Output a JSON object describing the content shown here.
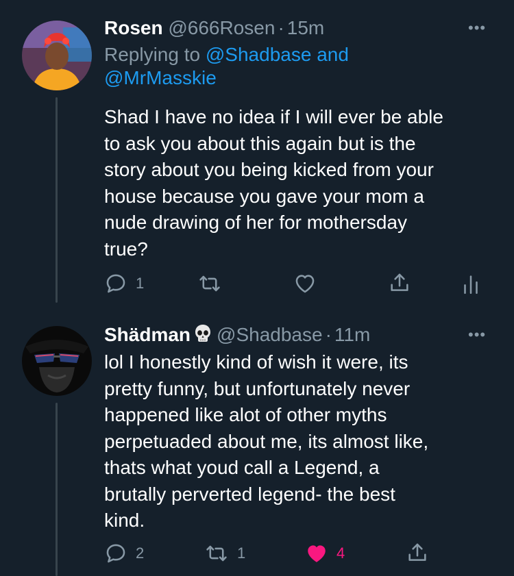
{
  "tweet1": {
    "display_name": "Rosen",
    "handle": "@666Rosen",
    "separator": "·",
    "time": "15m",
    "replying_prefix": "Replying to",
    "replying_user1": "@Shadbase",
    "replying_and": "and",
    "replying_user2": "@MrMasskie",
    "lines": [
      "Shad I have no idea if I will ever be able",
      "to ask you about this again but is the",
      "story about you being kicked from your",
      "house because you gave your mom a",
      "nude drawing of her for mothersday",
      "true?"
    ],
    "reply_count": "1",
    "retweet_count": "",
    "like_count": "",
    "more_icon": "more-horizontal-icon"
  },
  "tweet2": {
    "display_name": "Shädman",
    "name_emoji": "skull-icon",
    "handle": "@Shadbase",
    "separator": "·",
    "time": "11m",
    "lines": [
      "lol I honestly kind of wish it were, its",
      "pretty funny, but unfortunately never",
      "happened like alot of other myths",
      "perpetuaded about me, its almost like,",
      "thats what youd call a Legend, a",
      "brutally perverted legend- the best",
      "kind."
    ],
    "reply_count": "2",
    "retweet_count": "1",
    "like_count": "4",
    "liked": true,
    "more_icon": "more-horizontal-icon"
  },
  "colors": {
    "background": "#15202b",
    "text": "#ffffff",
    "muted": "#8899a6",
    "link": "#1d9bf0",
    "like": "#f91880",
    "thread_line": "#38444d"
  }
}
